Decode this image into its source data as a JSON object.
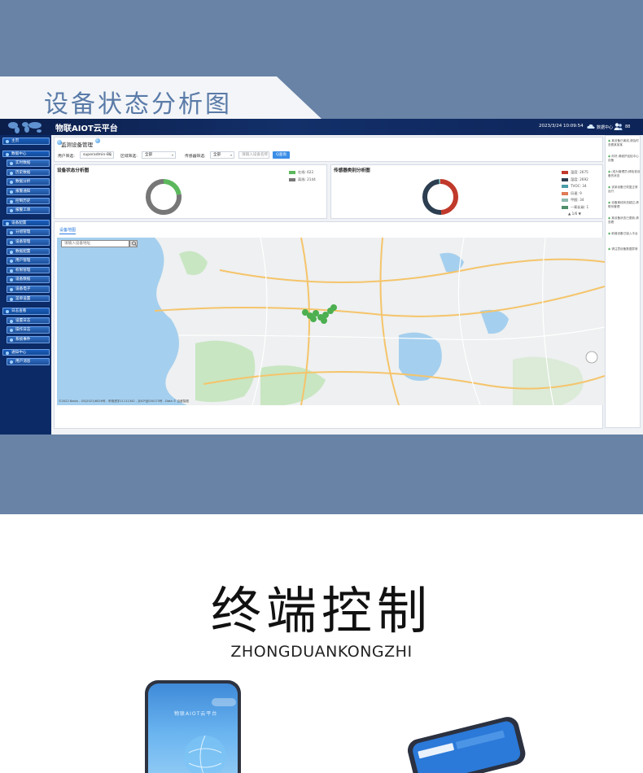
{
  "banner": {
    "title": "设备状态分析图"
  },
  "app": {
    "title": "物联AIOT云平台",
    "clock": "2023/3/24 10:09:54",
    "data_center": "数据中心",
    "user": "88"
  },
  "sidebar": {
    "items": [
      {
        "label": "主页",
        "type": "cat"
      },
      {
        "label": "数据中心",
        "type": "cat"
      },
      {
        "label": "实时数据",
        "type": "sub"
      },
      {
        "label": "历史数据",
        "type": "sub"
      },
      {
        "label": "数据分析",
        "type": "sub"
      },
      {
        "label": "报警通知",
        "type": "sub"
      },
      {
        "label": "控制历史",
        "type": "sub"
      },
      {
        "label": "报警工单",
        "type": "sub"
      },
      {
        "label": "设备配置",
        "type": "cat"
      },
      {
        "label": "分组管理",
        "type": "sub"
      },
      {
        "label": "设备管理",
        "type": "sub"
      },
      {
        "label": "数据配置",
        "type": "sub"
      },
      {
        "label": "用户管理",
        "type": "sub"
      },
      {
        "label": "权限管理",
        "type": "sub"
      },
      {
        "label": "设备数据",
        "type": "sub"
      },
      {
        "label": "设备电子",
        "type": "sub"
      },
      {
        "label": "菜单设置",
        "type": "sub"
      },
      {
        "label": "日志查看",
        "type": "cat"
      },
      {
        "label": "设置日志",
        "type": "sub"
      },
      {
        "label": "操作日志",
        "type": "sub"
      },
      {
        "label": "系统事件",
        "type": "sub"
      },
      {
        "label": "通知中心",
        "type": "cat"
      },
      {
        "label": "用户消息",
        "type": "sub"
      }
    ]
  },
  "filter": {
    "title": "监测设备管理",
    "user_label": "用户筛选:",
    "user_value": "superadmin-88",
    "area_label": "区域筛选:",
    "area_value": "全部",
    "sensor_label": "传感器筛选:",
    "sensor_value": "全部",
    "search_placeholder": "请输入设备名称",
    "query_button": "Q查询"
  },
  "status_panel": {
    "title": "设备状态分析图"
  },
  "sensor_panel": {
    "title": "传感器类别分析图",
    "pager": "1/6"
  },
  "map": {
    "tab": "设备地图",
    "search_placeholder": "请输入设备地址",
    "copyright": "©2022 Baidu - GS(2021)6026号 - 甲测资字11111342 - 京ICP证030173号 - Data © 百度智图"
  },
  "right_panel": {
    "lines": [
      "某设备已离线,请及时查看某某某",
      "你好,请维护巡检中心设备",
      "(成为管理员)请检查设备的状态",
      "该某设备已恢复正常运行",
      "设备离线状态超过,请联系管理",
      "某设备状态已更新,请查看",
      "新增设备已接入平台",
      "请注意设备数据异常"
    ]
  },
  "lower": {
    "title": "终端控制",
    "subtitle": "ZHONGDUANKONGZHI"
  },
  "phone": {
    "title": "物联AIOT云平台"
  },
  "chart_data": [
    {
      "type": "pie",
      "title": "设备状态分析图",
      "series": [
        {
          "name": "在线",
          "value": 622,
          "color": "#5cb85c"
        },
        {
          "name": "离线",
          "value": 2144,
          "color": "#777777"
        }
      ],
      "legend_labels": [
        "在线: 622",
        "离线: 2144"
      ]
    },
    {
      "type": "pie",
      "title": "传感器类别分析图",
      "series": [
        {
          "name": "温度",
          "value": 2675,
          "color": "#c0392b"
        },
        {
          "name": "湿度",
          "value": 2692,
          "color": "#2c3e50"
        },
        {
          "name": "TVOC",
          "value": 34,
          "color": "#4a9ca8"
        },
        {
          "name": "风速",
          "value": 9,
          "color": "#e07b54"
        },
        {
          "name": "甲醛",
          "value": 34,
          "color": "#8fb8ad"
        },
        {
          "name": "一氧化碳",
          "value": 1,
          "color": "#4f8f6a"
        }
      ],
      "legend_labels": [
        "温度: 2675",
        "湿度: 2692",
        "TVOC: 34",
        "风速: 9",
        "甲醛: 34",
        "一氧化碳: 1"
      ]
    }
  ]
}
